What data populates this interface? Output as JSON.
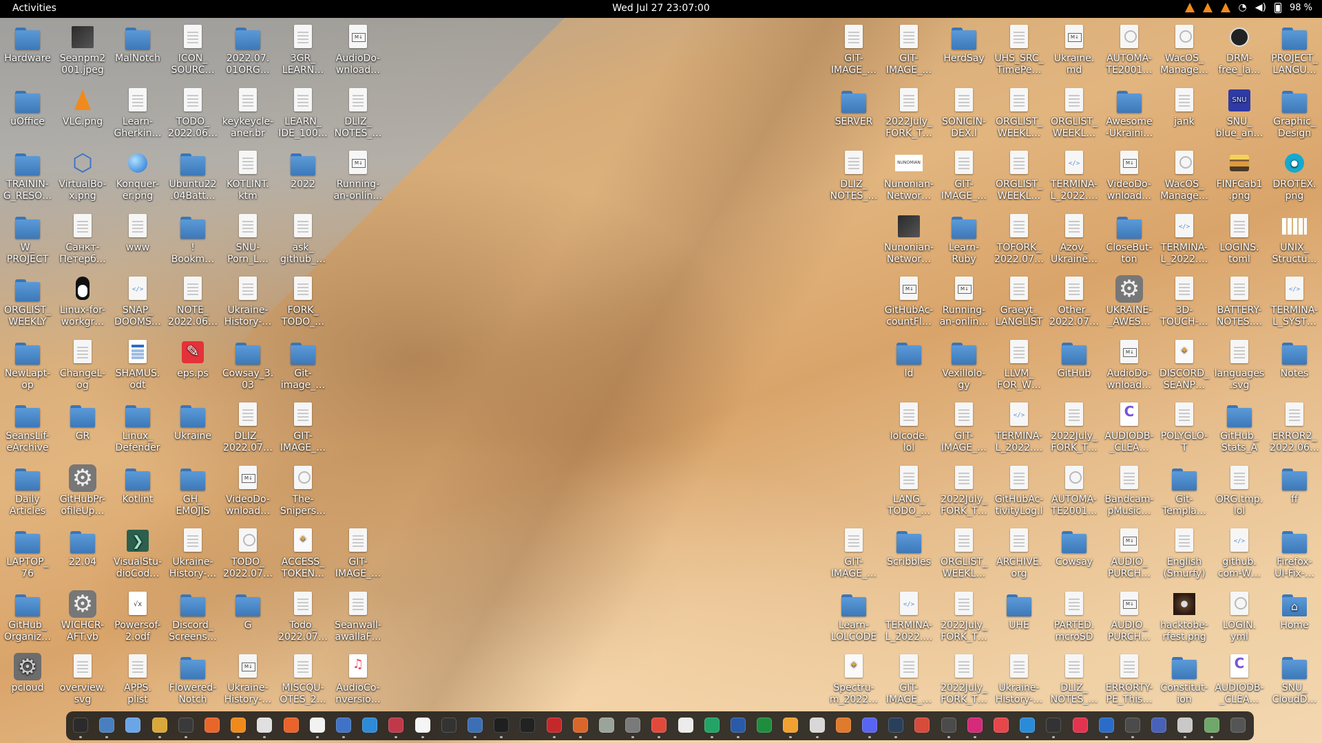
{
  "topbar": {
    "activities": "Activities",
    "clock": "Wed Jul 27  23:07:00",
    "battery": "98 %"
  },
  "desktop": {
    "left_icons": [
      {
        "label": "Hardware",
        "icon": "folder-icon"
      },
      {
        "label": "Seanpm2\n001.jpeg",
        "icon": "image-icon"
      },
      {
        "label": "MalNotch",
        "icon": "folder-icon"
      },
      {
        "label": "ICON_\nSOURC…",
        "icon": "text-file-icon"
      },
      {
        "label": "2022.07.\n01ORG…",
        "icon": "folder-icon"
      },
      {
        "label": "3GR_\nLEARN…",
        "icon": "text-file-icon"
      },
      {
        "label": "AudioDo-\nwnload…",
        "icon": "markdown-file-icon"
      },
      {
        "label": "uOffice",
        "icon": "folder-icon"
      },
      {
        "label": "VLC.png",
        "icon": "vlc-cone-icon"
      },
      {
        "label": "Learn-\nGherkin…",
        "icon": "text-file-icon"
      },
      {
        "label": "TODO_\n2022.06…",
        "icon": "text-file-icon"
      },
      {
        "label": "keykeycle-\naner.br",
        "icon": "text-file-icon"
      },
      {
        "label": "LEARN_\nIDE_100…",
        "icon": "text-file-icon"
      },
      {
        "label": "DLIZ_\nNOTES_…",
        "icon": "text-file-icon"
      },
      {
        "label": "TRAININ-\nG_RESO…",
        "icon": "folder-icon"
      },
      {
        "label": "VirtualBo-\nx.png",
        "icon": "virtualbox-icon"
      },
      {
        "label": "Konquer-\ner.png",
        "icon": "globe-icon"
      },
      {
        "label": "Ubuntu22\n.04Batt…",
        "icon": "folder-icon"
      },
      {
        "label": "KOTLINT.\nktm",
        "icon": "text-file-icon"
      },
      {
        "label": "2022",
        "icon": "folder-icon"
      },
      {
        "label": "Running-\nan-onlin…",
        "icon": "markdown-file-icon"
      },
      {
        "label": "W_\nPROJECT",
        "icon": "folder-icon"
      },
      {
        "label": "Санкт-\nПетерб…",
        "icon": "text-file-icon"
      },
      {
        "label": "www",
        "icon": "text-file-icon"
      },
      {
        "label": "!\nBookm…",
        "icon": "folder-icon"
      },
      {
        "label": "SNU-\nPorn_L…",
        "icon": "text-file-icon"
      },
      {
        "label": "ask_\ngithub_…",
        "icon": "text-file-icon"
      },
      {
        "label": "ORGLIST_\nWEEKLY",
        "icon": "folder-icon"
      },
      {
        "label": "Linux-for-\nworkgr…",
        "icon": "tux-icon"
      },
      {
        "label": "SNAP_\nDOOMS…",
        "icon": "code-file-icon"
      },
      {
        "label": "NOTE_\n2022.06…",
        "icon": "text-file-icon"
      },
      {
        "label": "Ukraine-\nHistory-…",
        "icon": "text-file-icon"
      },
      {
        "label": "FORK_\nTODO_…",
        "icon": "text-file-icon"
      },
      {
        "label": "NewLapt-\nop",
        "icon": "folder-icon"
      },
      {
        "label": "ChangeL-\nog",
        "icon": "text-file-icon"
      },
      {
        "label": "SHAMUS.\nodt",
        "icon": "odt-icon"
      },
      {
        "label": "eps.ps",
        "icon": "eps-icon"
      },
      {
        "label": "Cowsay_3.\n03",
        "icon": "folder-icon"
      },
      {
        "label": "Git-\nimage_…",
        "icon": "folder-icon"
      },
      {
        "label": "SeansLif-\neArchive",
        "icon": "folder-icon"
      },
      {
        "label": "GR",
        "icon": "folder-icon"
      },
      {
        "label": "Linux_\nDefender",
        "icon": "folder-icon"
      },
      {
        "label": "Ukraine",
        "icon": "folder-icon"
      },
      {
        "label": "DLIZ_\n2022.07…",
        "icon": "text-file-icon"
      },
      {
        "label": "GIT-\nIMAGE_…",
        "icon": "text-file-icon"
      },
      {
        "label": "Daily\nArticles",
        "icon": "folder-icon"
      },
      {
        "label": "GitHubPr-\nofileUp…",
        "icon": "gear-icon"
      },
      {
        "label": "Kotlint",
        "icon": "folder-icon"
      },
      {
        "label": "GH_\nEMOJIS",
        "icon": "folder-icon"
      },
      {
        "label": "VideoDo-\nwnload…",
        "icon": "markdown-file-icon"
      },
      {
        "label": "The-\nSnipers…",
        "icon": "yaml-file-icon"
      },
      {
        "label": "LAPTOP_\n76",
        "icon": "folder-icon"
      },
      {
        "label": "22.04",
        "icon": "folder-icon"
      },
      {
        "label": "VisualStu-\ndioCod…",
        "icon": "vscode-icon"
      },
      {
        "label": "Ukraine-\nHistory-…",
        "icon": "text-file-icon"
      },
      {
        "label": "TODO_\n2022.07…",
        "icon": "yaml-file-icon"
      },
      {
        "label": "ACCESS_\nTOKEN…",
        "icon": "svg-file-icon"
      },
      {
        "label": "GIT-\nIMAGE_…",
        "icon": "text-file-icon"
      },
      {
        "label": "GitHub_\nOrganiz…",
        "icon": "folder-icon"
      },
      {
        "label": "WICHCR-\nAFT.vb",
        "icon": "gear-icon"
      },
      {
        "label": "Powersof-\n2.odf",
        "icon": "odf-icon"
      },
      {
        "label": "Discord_\nScreens…",
        "icon": "folder-icon"
      },
      {
        "label": "G",
        "icon": "folder-icon"
      },
      {
        "label": "Todo_\n2022.07…",
        "icon": "text-file-icon"
      },
      {
        "label": "Seanwall-\nawallaF…",
        "icon": "text-file-icon"
      },
      {
        "label": "pcloud",
        "icon": "pcloud-icon"
      },
      {
        "label": "overview.\nsvg",
        "icon": "text-file-icon"
      },
      {
        "label": "APPS.\nplist",
        "icon": "text-file-icon"
      },
      {
        "label": "Flowered-\nNotch",
        "icon": "folder-icon"
      },
      {
        "label": "Ukraine-\nHistory-…",
        "icon": "markdown-file-icon"
      },
      {
        "label": "MISCQU-\nOTES_2…",
        "icon": "text-file-icon"
      },
      {
        "label": "AudioCo-\nnversio…",
        "icon": "audio-file-icon"
      }
    ],
    "right_icons": [
      {
        "label": "GIT-\nIMAGE_…",
        "icon": "text-file-icon"
      },
      {
        "label": "GIT-\nIMAGE_…",
        "icon": "text-file-icon"
      },
      {
        "label": "HerdSay",
        "icon": "folder-icon"
      },
      {
        "label": "UHS_SRC_\nTimePe…",
        "icon": "text-file-icon"
      },
      {
        "label": "Ukraine.\nmd",
        "icon": "markdown-file-icon"
      },
      {
        "label": "AUTOMA-\nTE2001…",
        "icon": "yaml-file-icon"
      },
      {
        "label": "WacOS_\nManage…",
        "icon": "yaml-file-icon"
      },
      {
        "label": "DRM-\nfree_la…",
        "icon": "badge-icon"
      },
      {
        "label": "PROJECT_\nLANGU…",
        "icon": "folder-icon"
      },
      {
        "label": "SERVER",
        "icon": "folder-icon"
      },
      {
        "label": "2022July_\nFORK_T…",
        "icon": "text-file-icon"
      },
      {
        "label": "SONICIN-\nDEX.l",
        "icon": "text-file-icon"
      },
      {
        "label": "ORGLIST_\nWEEKL…",
        "icon": "text-file-icon"
      },
      {
        "label": "ORGLIST_\nWEEKL…",
        "icon": "text-file-icon"
      },
      {
        "label": "Awesome\n-Ukraini…",
        "icon": "folder-icon"
      },
      {
        "label": "jank",
        "icon": "text-file-icon"
      },
      {
        "label": "SNU_\nblue_an…",
        "icon": "snu-image-icon"
      },
      {
        "label": "Graphic_\nDesign",
        "icon": "folder-icon"
      },
      {
        "label": "DLIZ_\nNOTES_…",
        "icon": "text-file-icon"
      },
      {
        "label": "Nunonian-\nNetwor…",
        "icon": "network-image-icon"
      },
      {
        "label": "GIT-\nIMAGE_…",
        "icon": "text-file-icon"
      },
      {
        "label": "ORGLIST_\nWEEKL…",
        "icon": "text-file-icon"
      },
      {
        "label": "TERMINA-\nL_2022.…",
        "icon": "code-file-icon"
      },
      {
        "label": "VideoDo-\nwnload…",
        "icon": "markdown-file-icon"
      },
      {
        "label": "WacOS_\nManage…",
        "icon": "yaml-file-icon"
      },
      {
        "label": "FINFCab1\n.png",
        "icon": "stack-image-icon"
      },
      {
        "label": "DROTEX.\npng",
        "icon": "drop-icon"
      },
      {
        "label": "Nunonian-\nNetwor…",
        "icon": "image-icon"
      },
      {
        "label": "Learn-\nRuby",
        "icon": "folder-icon"
      },
      {
        "label": "TOFORK_\n2022.07…",
        "icon": "text-file-icon"
      },
      {
        "label": "Azov_\nUkraine…",
        "icon": "text-file-icon"
      },
      {
        "label": "CloseBut-\nton",
        "icon": "folder-icon"
      },
      {
        "label": "TERMINA-\nL_2022.…",
        "icon": "code-file-icon"
      },
      {
        "label": "LOGINS.\ntoml",
        "icon": "text-file-icon"
      },
      {
        "label": "UNIX_\nStructu…",
        "icon": "unix-image-icon"
      },
      {
        "label": "GitHubAc-\ncountFl…",
        "icon": "markdown-file-icon"
      },
      {
        "label": "Running-\nan-onlin…",
        "icon": "markdown-file-icon"
      },
      {
        "label": "Graeyt_\nLANGLIST",
        "icon": "text-file-icon"
      },
      {
        "label": "Other_\n2022.07…",
        "icon": "text-file-icon"
      },
      {
        "label": "UKRAINE-\n_AWES…",
        "icon": "gear-icon"
      },
      {
        "label": "3D-\nTOUCH-…",
        "icon": "text-file-icon"
      },
      {
        "label": "BATTERY-\nNOTES.…",
        "icon": "text-file-icon"
      },
      {
        "label": "TERMINA-\nL_SYST…",
        "icon": "code-file-icon"
      },
      {
        "label": "ld",
        "icon": "folder-icon"
      },
      {
        "label": "Vexillolo-\ngy",
        "icon": "folder-icon"
      },
      {
        "label": "LLVM_\nFOR_W…",
        "icon": "text-file-icon"
      },
      {
        "label": "GitHub",
        "icon": "folder-icon"
      },
      {
        "label": "AudioDo-\nwnload…",
        "icon": "markdown-file-icon"
      },
      {
        "label": "DISCORD_\nSEANP…",
        "icon": "svg-file-icon"
      },
      {
        "label": "languages\n.svg",
        "icon": "text-file-icon"
      },
      {
        "label": "Notes",
        "icon": "folder-icon"
      },
      {
        "label": "lolcode.\nlol",
        "icon": "text-file-icon"
      },
      {
        "label": "GIT-\nIMAGE_…",
        "icon": "text-file-icon"
      },
      {
        "label": "TERMINA-\nL_2022.…",
        "icon": "code-file-icon"
      },
      {
        "label": "2022July_\nFORK_T…",
        "icon": "text-file-icon"
      },
      {
        "label": "AUDIODB-\n_CLEA…",
        "icon": "db-file-icon"
      },
      {
        "label": "POLYGLO-\nT",
        "icon": "text-file-icon"
      },
      {
        "label": "GitHub_\nStats_A",
        "icon": "folder-icon"
      },
      {
        "label": "ERROR2_\n2022.06…",
        "icon": "text-file-icon"
      },
      {
        "label": "LANG_\nTODO_…",
        "icon": "text-file-icon"
      },
      {
        "label": "2022July_\nFORK_T…",
        "icon": "text-file-icon"
      },
      {
        "label": "GitHubAc-\ntivityLog.l",
        "icon": "text-file-icon"
      },
      {
        "label": "AUTOMA-\nTE2001…",
        "icon": "yaml-file-icon"
      },
      {
        "label": "Bandcam-\npMusic…",
        "icon": "text-file-icon"
      },
      {
        "label": "Git-\nTempla…",
        "icon": "folder-icon"
      },
      {
        "label": "ORG.tmp.\nlol",
        "icon": "text-file-icon"
      },
      {
        "label": "ff",
        "icon": "folder-icon"
      },
      {
        "label": "GIT-\nIMAGE_…",
        "icon": "text-file-icon"
      },
      {
        "label": "Scribbles",
        "icon": "folder-icon"
      },
      {
        "label": "ORGLIST_\nWEEKL…",
        "icon": "text-file-icon"
      },
      {
        "label": "ARCHIVE.\norg",
        "icon": "text-file-icon"
      },
      {
        "label": "Cowsay",
        "icon": "folder-icon"
      },
      {
        "label": "AUDIO_\nPURCH…",
        "icon": "markdown-file-icon"
      },
      {
        "label": "English\n(Smurfy)",
        "icon": "text-file-icon"
      },
      {
        "label": "github.\ncom-W…",
        "icon": "code-file-icon"
      },
      {
        "label": "Firefox-\nUI-Fix-…",
        "icon": "folder-icon"
      },
      {
        "label": "Learn-\nLOLCODE",
        "icon": "folder-icon"
      },
      {
        "label": "TERMINA-\nL_2022.…",
        "icon": "code-file-icon"
      },
      {
        "label": "2022July_\nFORK_T…",
        "icon": "text-file-icon"
      },
      {
        "label": "UHE",
        "icon": "folder-icon"
      },
      {
        "label": "PARTED.\nmcroSD",
        "icon": "text-file-icon"
      },
      {
        "label": "AUDIO_\nPURCH…",
        "icon": "markdown-file-icon"
      },
      {
        "label": "hacktobe-\nrfest.png",
        "icon": "hacktoberfest-image-icon"
      },
      {
        "label": "LOGIN.\nyml",
        "icon": "yaml-file-icon"
      },
      {
        "label": "Home",
        "icon": "home-folder-icon"
      },
      {
        "label": "Spectru-\nm_2022…",
        "icon": "svg-file-icon"
      },
      {
        "label": "GIT-\nIMAGE_…",
        "icon": "text-file-icon"
      },
      {
        "label": "2022July_\nFORK_T…",
        "icon": "text-file-icon"
      },
      {
        "label": "Ukraine-\nHistory-…",
        "icon": "text-file-icon"
      },
      {
        "label": "DLIZ_\nNOTES_…",
        "icon": "text-file-icon"
      },
      {
        "label": "ERRORTY-\nPE_This…",
        "icon": "text-file-icon"
      },
      {
        "label": "Constitut-\nion",
        "icon": "folder-icon"
      },
      {
        "label": "AUDIODB-\n_CLEA…",
        "icon": "db-file-icon"
      },
      {
        "label": "SNU_\nCloudD…",
        "icon": "folder-icon"
      }
    ]
  },
  "dock": {
    "apps": [
      {
        "name": "terminal-icon",
        "color": "#2b2b2b"
      },
      {
        "name": "files-icon",
        "color": "#4a7fbf"
      },
      {
        "name": "text-editor-icon",
        "color": "#6aa5e8"
      },
      {
        "name": "archive-icon",
        "color": "#d9a83a"
      },
      {
        "name": "console-icon",
        "color": "#3a3a3a"
      },
      {
        "name": "firefox-icon",
        "color": "#e8662a"
      },
      {
        "name": "vlc-icon",
        "color": "#f08a1c"
      },
      {
        "name": "podcast-icon",
        "color": "#e0e0e0"
      },
      {
        "name": "software-center-icon",
        "color": "#e9632b"
      },
      {
        "name": "notes-icon",
        "color": "#f2f2f2"
      },
      {
        "name": "document-viewer-icon",
        "color": "#3f73c5"
      },
      {
        "name": "help-icon",
        "color": "#2e8bd8"
      },
      {
        "name": "system-monitor-icon",
        "color": "#c0394a"
      },
      {
        "name": "blank-doc-icon",
        "color": "#f5f5f5"
      },
      {
        "name": "screenshot-icon",
        "color": "#333333"
      },
      {
        "name": "virtualbox-icon",
        "color": "#3d6fb6"
      },
      {
        "name": "obs-icon",
        "color": "#1f1f1f"
      },
      {
        "name": "inkscape-icon",
        "color": "#222222"
      },
      {
        "name": "ruby-icon",
        "color": "#c5282b"
      },
      {
        "name": "gitkraken-icon",
        "color": "#d9662a"
      },
      {
        "name": "libreoffice-icon",
        "color": "#9aa49a"
      },
      {
        "name": "scanner-icon",
        "color": "#7a7a7a"
      },
      {
        "name": "chrome-icon",
        "color": "#e14a3b"
      },
      {
        "name": "writer-icon",
        "color": "#ececec"
      },
      {
        "name": "spreadsheet-icon",
        "color": "#23a365"
      },
      {
        "name": "camera-icon",
        "color": "#2a5aa8"
      },
      {
        "name": "calc-icon",
        "color": "#1e8e3e"
      },
      {
        "name": "amber-file-icon",
        "color": "#f1a131"
      },
      {
        "name": "install-icon",
        "color": "#d8d8d8"
      },
      {
        "name": "presentation-icon",
        "color": "#e07a2c"
      },
      {
        "name": "discord-icon",
        "color": "#5865f2"
      },
      {
        "name": "steam-icon",
        "color": "#2a3f5a"
      },
      {
        "name": "pdf-icon",
        "color": "#d64b3a"
      },
      {
        "name": "vector-icon",
        "color": "#4b4b4b"
      },
      {
        "name": "media-player-icon",
        "color": "#d62a7a"
      },
      {
        "name": "calendar-icon",
        "color": "#e5474b"
      },
      {
        "name": "mail-icon",
        "color": "#2a8bd8"
      },
      {
        "name": "github-icon",
        "color": "#333333"
      },
      {
        "name": "heart-app-icon",
        "color": "#e3344f"
      },
      {
        "name": "outlook-icon",
        "color": "#2b6cc8"
      },
      {
        "name": "sheets-icon",
        "color": "#4b4b4b"
      },
      {
        "name": "teams-icon",
        "color": "#4762b8"
      },
      {
        "name": "settings-icon",
        "color": "#c9c9c9"
      },
      {
        "name": "trash-icon",
        "color": "#6fa86a"
      },
      {
        "name": "show-apps-icon",
        "color": "#555555"
      }
    ]
  }
}
